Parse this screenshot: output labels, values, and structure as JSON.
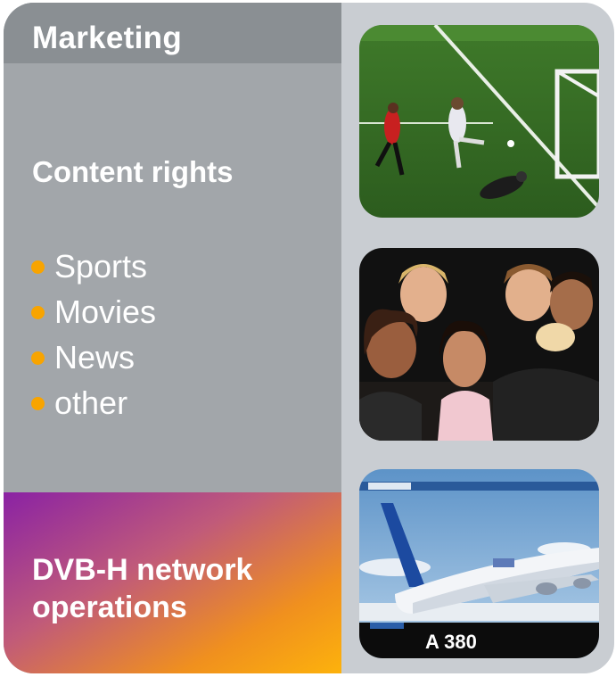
{
  "header": {
    "title": "Marketing"
  },
  "content": {
    "title": "Content rights",
    "bullets": [
      "Sports",
      "Movies",
      "News",
      "other"
    ]
  },
  "network": {
    "title_line1": "DVB-H network",
    "title_line2": "operations"
  },
  "images": {
    "soccer": {
      "icon": "soccer-match-photo"
    },
    "people": {
      "icon": "group-of-friends-photo"
    },
    "airplane": {
      "icon": "airplane-photo",
      "caption": "A 380"
    }
  },
  "colors": {
    "bullet": "#f8a400",
    "panel": "#a2a6aa",
    "header": "#8a8f93",
    "gradient_start": "#8a22a4",
    "gradient_end": "#fdb20c"
  }
}
